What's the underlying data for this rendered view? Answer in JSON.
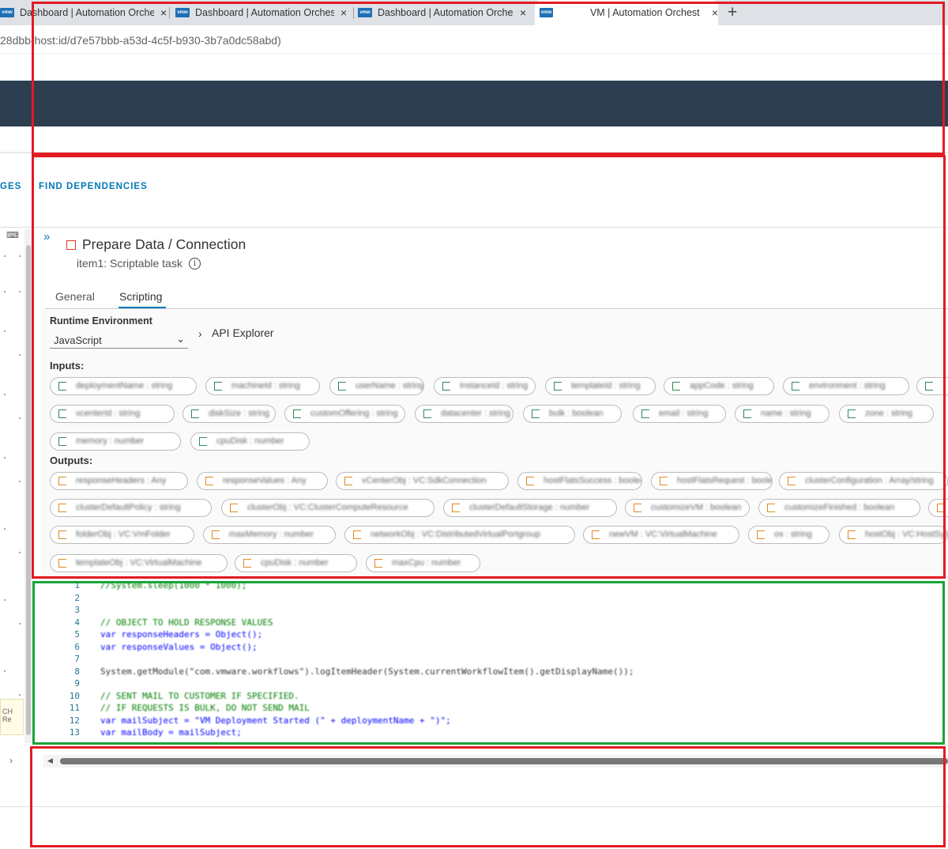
{
  "browser": {
    "tabs": [
      {
        "label": "Dashboard | Automation Orchestr",
        "favicon": "vmw"
      },
      {
        "label": "Dashboard | Automation Orchestr",
        "favicon": "vmw"
      },
      {
        "label": "Dashboard | Automation Orchestr",
        "favicon": "vmw"
      },
      {
        "label": "VM | Automation Orchest",
        "favicon": "vmw",
        "active": true
      }
    ],
    "new_tab": "+",
    "close": "×",
    "address": "28dbb(host:id/d7e57bbb-a53d-4c5f-b930-3b7a0dc58abd)"
  },
  "top_tabs": {
    "changes": "GES",
    "find_dependencies": "FIND DEPENDENCIES"
  },
  "task": {
    "expand": "»",
    "title": "Prepare Data / Connection",
    "subtitle": "item1: Scriptable task",
    "info": "i"
  },
  "tabs": {
    "general": "General",
    "scripting": "Scripting"
  },
  "runtime": {
    "label": "Runtime Environment",
    "value": "JavaScript",
    "chevron": "⌄",
    "api_chevron": "›",
    "api_explorer": "API Explorer"
  },
  "inputs_label": "Inputs:",
  "outputs_label": "Outputs:",
  "input_chips": [
    "deploymentName : string",
    "machineId : string",
    "userName : string",
    "instanceId : string",
    "templateId : string",
    "appCode : string",
    "environment : string",
    "",
    "vcenterId : string",
    "diskSize : string",
    "customOffering : string",
    "datacenter : string",
    "bulk : boolean",
    "email : string",
    "name : string",
    "zone : string",
    "memory : number",
    "cpuDisk : number"
  ],
  "output_chips": [
    "responseHeaders : Any",
    "responseValues : Any",
    "vCenterObj : VC:SdkConnection",
    "hostFlatsSuccess : boolean",
    "hostFlatsRequest : boolean",
    "clusterConfiguration : Array/string",
    "clusterDefaultPolicy : string",
    "clusterObj : VC:ClusterComputeResource",
    "clusterDefaultStorage : number",
    "customizeVM : boolean",
    "customizeFinished : boolean",
    "",
    "folderObj : VC:VmFolder",
    "maxMemory : number",
    "networkObj : VC:DistributedVirtualPortgroup",
    "newVM : VC:VirtualMachine",
    "os : string",
    "hostObj : VC:HostSystem",
    "templateObj : VC:VirtualMachine",
    "cpuDisk : number",
    "maxCpu : number"
  ],
  "code": {
    "lines": [
      {
        "n": "1",
        "text": "//System.sleep(1000 * 1000);",
        "cls": "cm"
      },
      {
        "n": "2",
        "text": "",
        "cls": "pl"
      },
      {
        "n": "3",
        "text": "",
        "cls": "pl"
      },
      {
        "n": "4",
        "text": "// OBJECT TO HOLD RESPONSE VALUES",
        "cls": "cm"
      },
      {
        "n": "5",
        "text": "var responseHeaders = Object();",
        "cls": "kw"
      },
      {
        "n": "6",
        "text": "var responseValues = Object();",
        "cls": "kw"
      },
      {
        "n": "7",
        "text": "",
        "cls": "pl"
      },
      {
        "n": "8",
        "text": "System.getModule(\"com.vmware.workflows\").logItemHeader(System.currentWorkflowItem().getDisplayName());",
        "cls": "pl"
      },
      {
        "n": "9",
        "text": "",
        "cls": "pl"
      },
      {
        "n": "10",
        "text": "// SENT MAIL TO CUSTOMER IF SPECIFIED.",
        "cls": "cm"
      },
      {
        "n": "11",
        "text": "// IF REQUESTS IS BULK, DO NOT SEND MAIL",
        "cls": "cm"
      },
      {
        "n": "12",
        "text": "var mailSubject = \"VM Deployment Started (\" + deploymentName + \")\";",
        "cls": "kw"
      },
      {
        "n": "13",
        "text": "var mailBody = mailSubject;",
        "cls": "kw"
      }
    ]
  },
  "sidebar": {
    "tip_text": "CH Re"
  },
  "scroll": {
    "left_arrow": "◀",
    "left_chevron": "›"
  },
  "annotations": {
    "red": "#e21b23",
    "green": "#1aa33a"
  }
}
